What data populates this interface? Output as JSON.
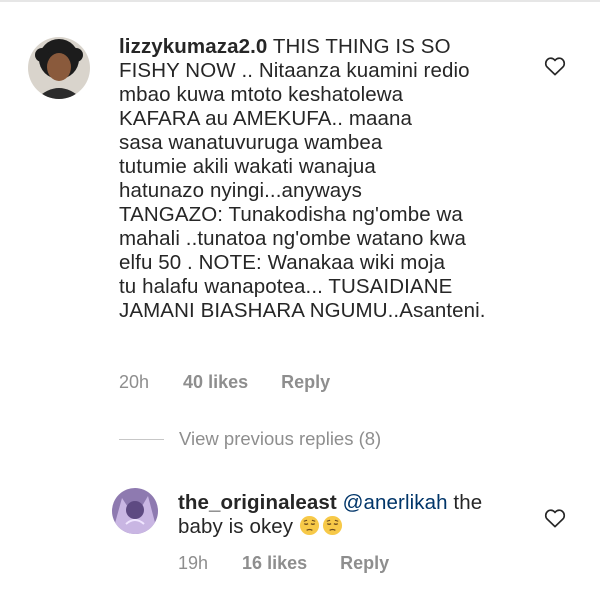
{
  "comment1": {
    "username": "lizzykumaza2.0",
    "text_lines": [
      "THIS THING IS SO",
      "FISHY NOW .. Nitaanza kuamini redio",
      "mbao kuwa mtoto keshatolewa",
      "KAFARA au AMEKUFA.. maana",
      "sasa wanatuvuruga wambea",
      "tutumie akili wakati wanajua",
      "hatunazo  nyingi...anyways",
      "TANGAZO: Tunakodisha ng'ombe wa",
      "mahali ..tunatoa ng'ombe watano kwa",
      "elfu 50 . NOTE: Wanakaa wiki moja",
      "tu halafu wanapotea... TUSAIDIANE",
      "JAMANI BIASHARA NGUMU..Asanteni."
    ],
    "time": "20h",
    "likes": "40 likes",
    "reply": "Reply"
  },
  "view_replies": "View previous replies (8)",
  "reply1": {
    "username": "the_originaleast",
    "mention": "@anerlikah",
    "text_after_mention": " the",
    "text_line2": "baby is okey",
    "emojis": [
      "pensive-face",
      "pensive-face"
    ],
    "time": "19h",
    "likes": "16 likes",
    "reply": "Reply"
  },
  "colors": {
    "text": "#262626",
    "secondary": "#8e8e8e",
    "mention": "#003569",
    "emoji": "#f7c948"
  }
}
